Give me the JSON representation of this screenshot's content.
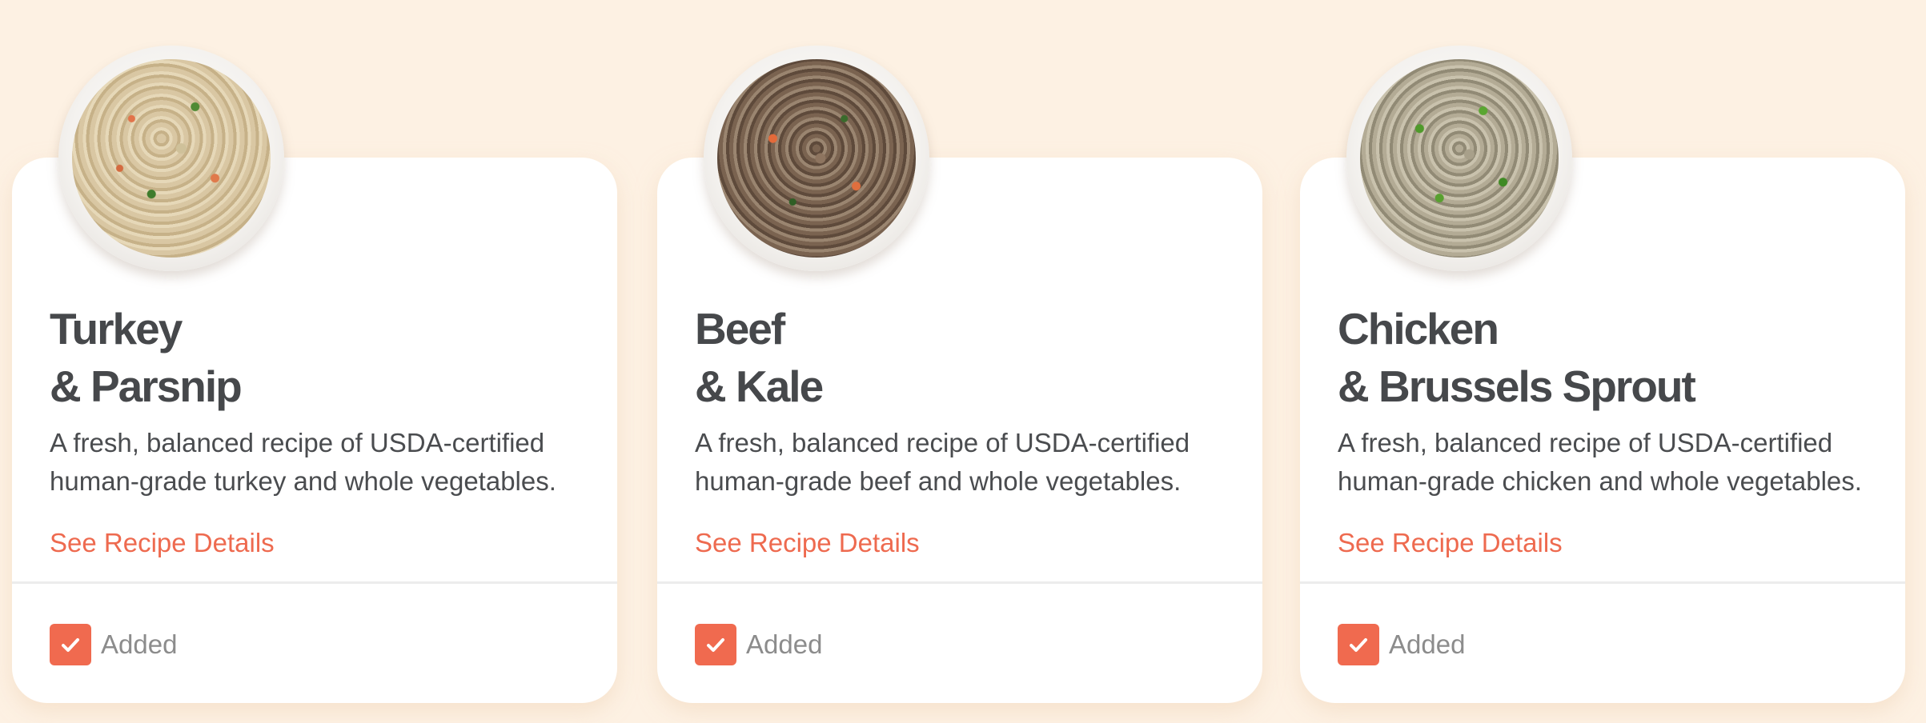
{
  "colors": {
    "background": "#fdf1e3",
    "card": "#ffffff",
    "title_text": "#46484b",
    "body_text": "#4a4c4f",
    "accent": "#ee6a4f",
    "muted_text": "#8c8c8c",
    "divider": "#ececec"
  },
  "recipes": [
    {
      "image_icon": "turkey-parsnip-bowl-image",
      "title_line1": "Turkey",
      "title_line2": "& Parsnip",
      "desc_line1": "A fresh, balanced recipe of USDA-certified",
      "desc_line2": "human-grade turkey and whole vegetables.",
      "link_label": "See Recipe Details",
      "status_label": "Added",
      "checked": true
    },
    {
      "image_icon": "beef-kale-bowl-image",
      "title_line1": "Beef",
      "title_line2": "& Kale",
      "desc_line1": "A fresh, balanced recipe of USDA-certified",
      "desc_line2": "human-grade beef and whole vegetables.",
      "link_label": "See Recipe Details",
      "status_label": "Added",
      "checked": true
    },
    {
      "image_icon": "chicken-brussels-sprout-bowl-image",
      "title_line1": "Chicken",
      "title_line2": "& Brussels Sprout",
      "desc_line1": "A fresh, balanced recipe of USDA-certified",
      "desc_line2": "human-grade chicken and whole vegetables.",
      "link_label": "See Recipe Details",
      "status_label": "Added",
      "checked": true
    }
  ]
}
